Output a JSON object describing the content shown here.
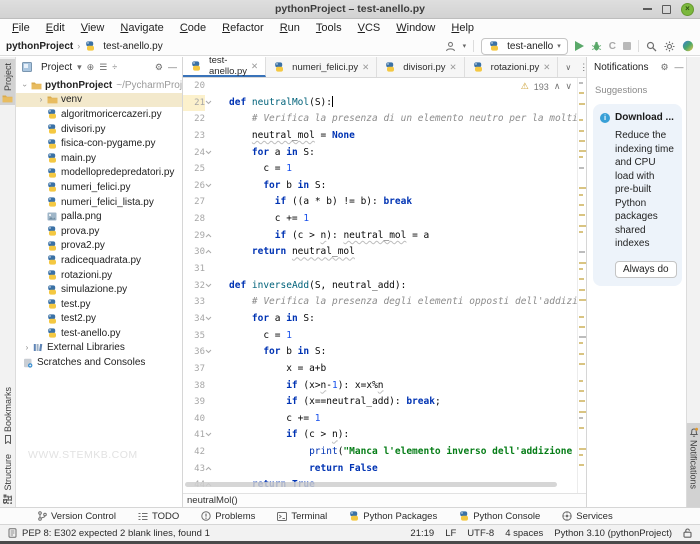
{
  "window": {
    "title": "pythonProject – test-anello.py"
  },
  "menu": {
    "items": [
      "File",
      "Edit",
      "View",
      "Navigate",
      "Code",
      "Refactor",
      "Run",
      "Tools",
      "VCS",
      "Window",
      "Help"
    ]
  },
  "toolbar": {
    "breadcrumb": {
      "project": "pythonProject",
      "file": "test-anello.py"
    },
    "run_config": "test-anello"
  },
  "left_stripe": {
    "tabs": [
      "Project",
      "Bookmarks",
      "Structure"
    ]
  },
  "right_stripe": {
    "tabs": [
      "Notifications"
    ]
  },
  "project": {
    "header": "Project",
    "root": {
      "name": "pythonProject",
      "hint": "~/PycharmProje"
    },
    "items": [
      {
        "name": "venv",
        "type": "folder",
        "level": 1,
        "arrow": "closed",
        "selected": true
      },
      {
        "name": "algoritmoricercazeri.py",
        "type": "py",
        "level": 1
      },
      {
        "name": "divisori.py",
        "type": "py",
        "level": 1
      },
      {
        "name": "fisica-con-pygame.py",
        "type": "py",
        "level": 1
      },
      {
        "name": "main.py",
        "type": "py",
        "level": 1
      },
      {
        "name": "modellopredepredatori.py",
        "type": "py",
        "level": 1
      },
      {
        "name": "numeri_felici.py",
        "type": "py",
        "level": 1
      },
      {
        "name": "numeri_felici_lista.py",
        "type": "py",
        "level": 1
      },
      {
        "name": "palla.png",
        "type": "img",
        "level": 1
      },
      {
        "name": "prova.py",
        "type": "py",
        "level": 1
      },
      {
        "name": "prova2.py",
        "type": "py",
        "level": 1
      },
      {
        "name": "radicequadrata.py",
        "type": "py",
        "level": 1
      },
      {
        "name": "rotazioni.py",
        "type": "py",
        "level": 1
      },
      {
        "name": "simulazione.py",
        "type": "py",
        "level": 1
      },
      {
        "name": "test.py",
        "type": "py",
        "level": 1
      },
      {
        "name": "test2.py",
        "type": "py",
        "level": 1
      },
      {
        "name": "test-anello.py",
        "type": "py",
        "level": 1
      },
      {
        "name": "External Libraries",
        "type": "lib",
        "level": 0,
        "arrow": "closed"
      },
      {
        "name": "Scratches and Consoles",
        "type": "scratch",
        "level": 0
      }
    ],
    "watermark": "WWW.STEMKB.COM"
  },
  "tabs": [
    {
      "label": "test-anello.py",
      "active": true
    },
    {
      "label": "numeri_felici.py",
      "active": false
    },
    {
      "label": "divisori.py",
      "active": false
    },
    {
      "label": "rotazioni.py",
      "active": false
    }
  ],
  "editor": {
    "warning_count": "193",
    "breadcrumb": "neutralMol()",
    "lines": [
      {
        "n": "20",
        "tokens": []
      },
      {
        "n": "21",
        "cur": true,
        "caret": true,
        "fold": "v",
        "tokens": [
          [
            "kw",
            "def"
          ],
          [
            "pl",
            " "
          ],
          [
            "fn",
            "neutralMol"
          ],
          [
            "pl",
            "(S):"
          ]
        ]
      },
      {
        "n": "22",
        "tokens": [
          [
            "pl",
            "    "
          ],
          [
            "com",
            "# Verifica la presenza di un elemento neutro per la moltiplicazione"
          ]
        ]
      },
      {
        "n": "23",
        "tokens": [
          [
            "pl",
            "    "
          ],
          [
            "wk",
            "neutral_mol"
          ],
          [
            "pl",
            " = "
          ],
          [
            "kw",
            "None"
          ]
        ]
      },
      {
        "n": "24",
        "fold": "v",
        "tokens": [
          [
            "pl",
            "    "
          ],
          [
            "kw",
            "for"
          ],
          [
            "pl",
            " a "
          ],
          [
            "kw",
            "in"
          ],
          [
            "pl",
            " S:"
          ]
        ]
      },
      {
        "n": "25",
        "tokens": [
          [
            "pl",
            "      c = "
          ],
          [
            "num",
            "1"
          ]
        ]
      },
      {
        "n": "26",
        "fold": "v",
        "tokens": [
          [
            "pl",
            "      "
          ],
          [
            "kw",
            "for"
          ],
          [
            "pl",
            " b "
          ],
          [
            "kw",
            "in"
          ],
          [
            "pl",
            " S:"
          ]
        ]
      },
      {
        "n": "27",
        "tokens": [
          [
            "pl",
            "        "
          ],
          [
            "kw",
            "if"
          ],
          [
            "pl",
            " ((a * b) != b): "
          ],
          [
            "kw",
            "break"
          ]
        ]
      },
      {
        "n": "28",
        "tokens": [
          [
            "pl",
            "        c += "
          ],
          [
            "num",
            "1"
          ]
        ]
      },
      {
        "n": "29",
        "fold": "^",
        "tokens": [
          [
            "pl",
            "        "
          ],
          [
            "kw",
            "if"
          ],
          [
            "pl",
            " (c > "
          ],
          [
            "wk",
            "n"
          ],
          [
            "pl",
            "): "
          ],
          [
            "wk",
            "neutral_mol"
          ],
          [
            "pl",
            " = a"
          ]
        ]
      },
      {
        "n": "30",
        "fold": "^",
        "tokens": [
          [
            "pl",
            "    "
          ],
          [
            "kw",
            "return"
          ],
          [
            "pl",
            " "
          ],
          [
            "wk",
            "neutral_mol"
          ]
        ]
      },
      {
        "n": "31",
        "tokens": []
      },
      {
        "n": "32",
        "fold": "v",
        "tokens": [
          [
            "kw",
            "def"
          ],
          [
            "pl",
            " "
          ],
          [
            "fn",
            "inverseAdd"
          ],
          [
            "pl",
            "(S, neutral_add):"
          ]
        ]
      },
      {
        "n": "33",
        "tokens": [
          [
            "pl",
            "    "
          ],
          [
            "com",
            "# Verifica la presenza degli elementi opposti dell'addizione"
          ]
        ]
      },
      {
        "n": "34",
        "fold": "v",
        "tokens": [
          [
            "pl",
            "    "
          ],
          [
            "kw",
            "for"
          ],
          [
            "pl",
            " a "
          ],
          [
            "kw",
            "in"
          ],
          [
            "pl",
            " S:"
          ]
        ]
      },
      {
        "n": "35",
        "tokens": [
          [
            "pl",
            "      c = "
          ],
          [
            "num",
            "1"
          ]
        ]
      },
      {
        "n": "36",
        "fold": "v",
        "tokens": [
          [
            "pl",
            "      "
          ],
          [
            "kw",
            "for"
          ],
          [
            "pl",
            " b "
          ],
          [
            "kw",
            "in"
          ],
          [
            "pl",
            " S:"
          ]
        ]
      },
      {
        "n": "37",
        "tokens": [
          [
            "pl",
            "          x = a+b"
          ]
        ]
      },
      {
        "n": "38",
        "tokens": [
          [
            "pl",
            "          "
          ],
          [
            "kw",
            "if"
          ],
          [
            "pl",
            " (x>"
          ],
          [
            "wk",
            "n"
          ],
          [
            "pl",
            "-"
          ],
          [
            "num",
            "1"
          ],
          [
            "pl",
            "): x=x%"
          ],
          [
            "wk",
            "n"
          ]
        ]
      },
      {
        "n": "39",
        "tokens": [
          [
            "pl",
            "          "
          ],
          [
            "kw",
            "if"
          ],
          [
            "pl",
            " (x==neutral_add): "
          ],
          [
            "kw",
            "break"
          ],
          [
            "pl",
            ";"
          ]
        ]
      },
      {
        "n": "40",
        "tokens": [
          [
            "pl",
            "          c += "
          ],
          [
            "num",
            "1"
          ]
        ]
      },
      {
        "n": "41",
        "fold": "v",
        "tokens": [
          [
            "pl",
            "          "
          ],
          [
            "kw",
            "if"
          ],
          [
            "pl",
            " (c > "
          ],
          [
            "wk",
            "n"
          ],
          [
            "pl",
            "):"
          ]
        ]
      },
      {
        "n": "42",
        "tokens": [
          [
            "pl",
            "              "
          ],
          [
            "bi",
            "print"
          ],
          [
            "pl",
            "("
          ],
          [
            "str",
            "\"Manca l'elemento inverso dell'addizione per"
          ]
        ]
      },
      {
        "n": "43",
        "fold": "^",
        "tokens": [
          [
            "pl",
            "              "
          ],
          [
            "kw",
            "return"
          ],
          [
            "pl",
            " "
          ],
          [
            "kw",
            "False"
          ]
        ]
      },
      {
        "n": "44",
        "fold": "^",
        "tokens": [
          [
            "pl",
            "    "
          ],
          [
            "kw",
            "return"
          ],
          [
            "pl",
            " "
          ],
          [
            "kw",
            "True"
          ]
        ]
      }
    ]
  },
  "notifications": {
    "title": "Notifications",
    "section": "Suggestions",
    "card": {
      "title": "Download ...",
      "body": "Reduce the indexing time and CPU load with pre-built Python packages shared indexes",
      "button": "Always do"
    }
  },
  "bottom_bar": {
    "items": [
      "Version Control",
      "TODO",
      "Problems",
      "Terminal",
      "Python Packages",
      "Python Console",
      "Services"
    ]
  },
  "status_bar": {
    "message": "PEP 8: E302 expected 2 blank lines, found 1",
    "position": "21:19",
    "line_separator": "LF",
    "encoding": "UTF-8",
    "indent": "4 spaces",
    "interpreter": "Python 3.10 (pythonProject)"
  }
}
